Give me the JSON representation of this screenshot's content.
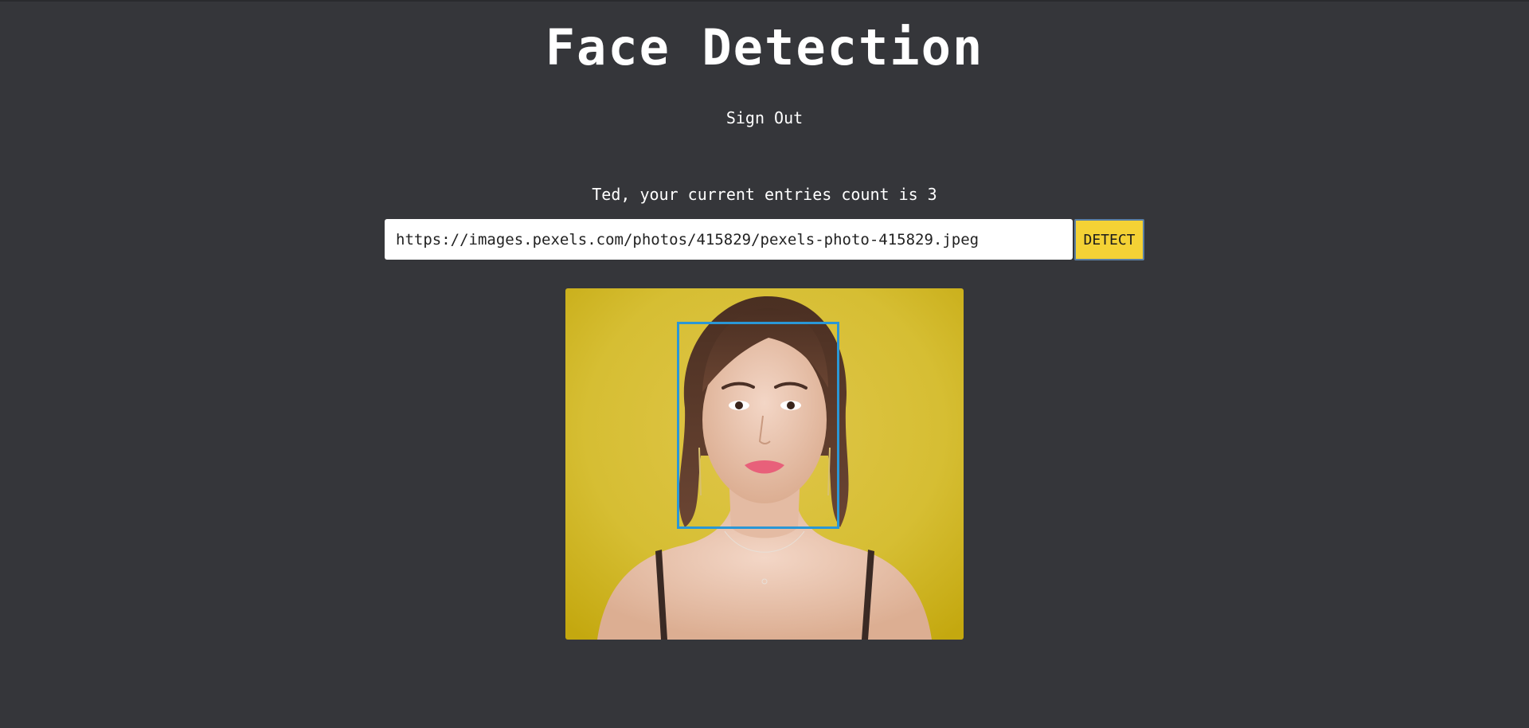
{
  "header": {
    "title": "Face Detection",
    "sign_out_label": "Sign Out"
  },
  "main": {
    "entries_text": "Ted, your current entries count is 3",
    "url_input_value": "https://images.pexels.com/photos/415829/pexels-photo-415829.jpeg",
    "detect_label": "DETECT",
    "accent_color": "#f4d235",
    "face_box_color": "#2a97d6",
    "background_color": "#35363a"
  },
  "icons": {
    "photo": "portrait-photo"
  }
}
